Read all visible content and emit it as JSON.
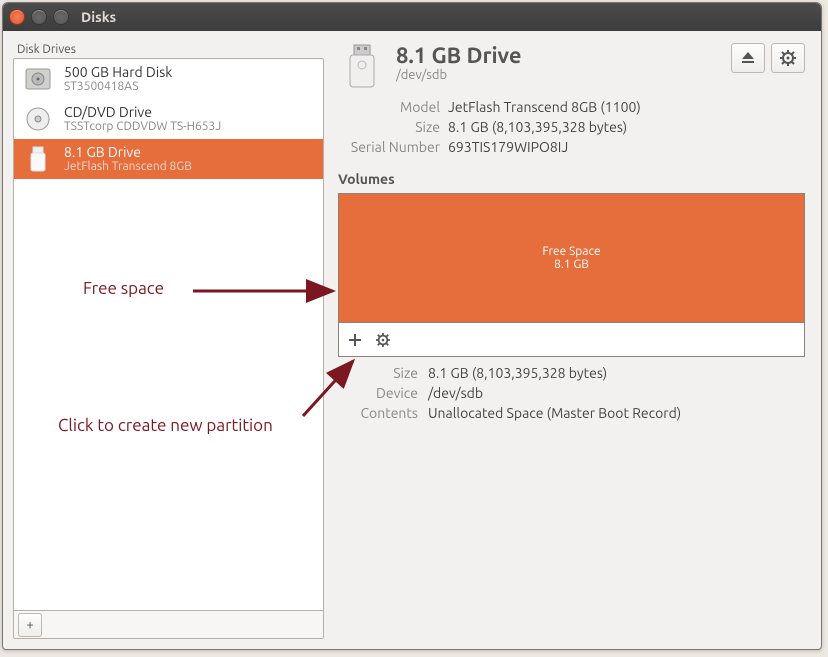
{
  "window_title": "Disks",
  "sidebar": {
    "label": "Disk Drives",
    "items": [
      {
        "title": "500 GB Hard Disk",
        "sub": "ST3500418AS",
        "kind": "hdd"
      },
      {
        "title": "CD/DVD Drive",
        "sub": "TSSTcorp CDDVDW TS-H653J",
        "kind": "optical"
      },
      {
        "title": "8.1 GB Drive",
        "sub": "JetFlash Transcend 8GB",
        "kind": "usb"
      }
    ]
  },
  "header": {
    "title": "8.1 GB Drive",
    "device": "/dev/sdb"
  },
  "drive_info": {
    "model_label": "Model",
    "model": "JetFlash Transcend 8GB (1100)",
    "size_label": "Size",
    "size": "8.1 GB (8,103,395,328 bytes)",
    "serial_label": "Serial Number",
    "serial": "693TIS179WIPO8IJ"
  },
  "volumes": {
    "heading": "Volumes",
    "free_label": "Free Space",
    "free_size": "8.1 GB"
  },
  "vol_detail": {
    "size_label": "Size",
    "size": "8.1 GB (8,103,395,328 bytes)",
    "device_label": "Device",
    "device": "/dev/sdb",
    "contents_label": "Contents",
    "contents": "Unallocated Space (Master Boot Record)"
  },
  "annotations": {
    "freespace": "Free space",
    "newpart": "Click to create new partition"
  }
}
